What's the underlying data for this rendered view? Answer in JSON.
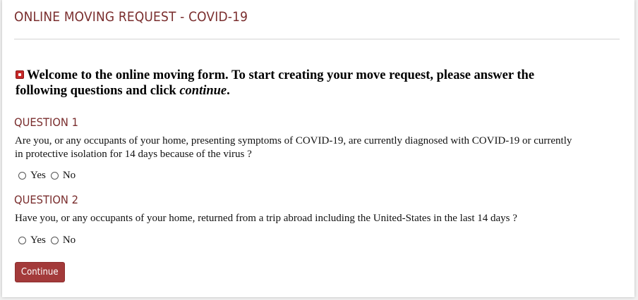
{
  "header": {
    "title": "ONLINE MOVING REQUEST - COVID-19"
  },
  "intro": {
    "icon": "square-bullet-icon",
    "text_main": "Welcome to the online moving form. To start creating your move request, please answer the following questions and click ",
    "text_emphasis": "continue",
    "text_end": "."
  },
  "questions": [
    {
      "heading": "QUESTION 1",
      "text": "Are you, or any occupants of your home, presenting symptoms of COVID-19, are currently diagnosed with COVID-19 or currently in protective isolation for 14 days because of the virus ?",
      "options": [
        "Yes",
        "No"
      ]
    },
    {
      "heading": "QUESTION 2",
      "text": "Have you, or any occupants of your home, returned from a trip abroad including the United-States in the last 14 days ?",
      "options": [
        "Yes",
        "No"
      ]
    }
  ],
  "form": {
    "continue_label": "Continue"
  },
  "colors": {
    "brand": "#7a2e2e",
    "button": "#a33a3a",
    "bullet": "#c62828"
  }
}
